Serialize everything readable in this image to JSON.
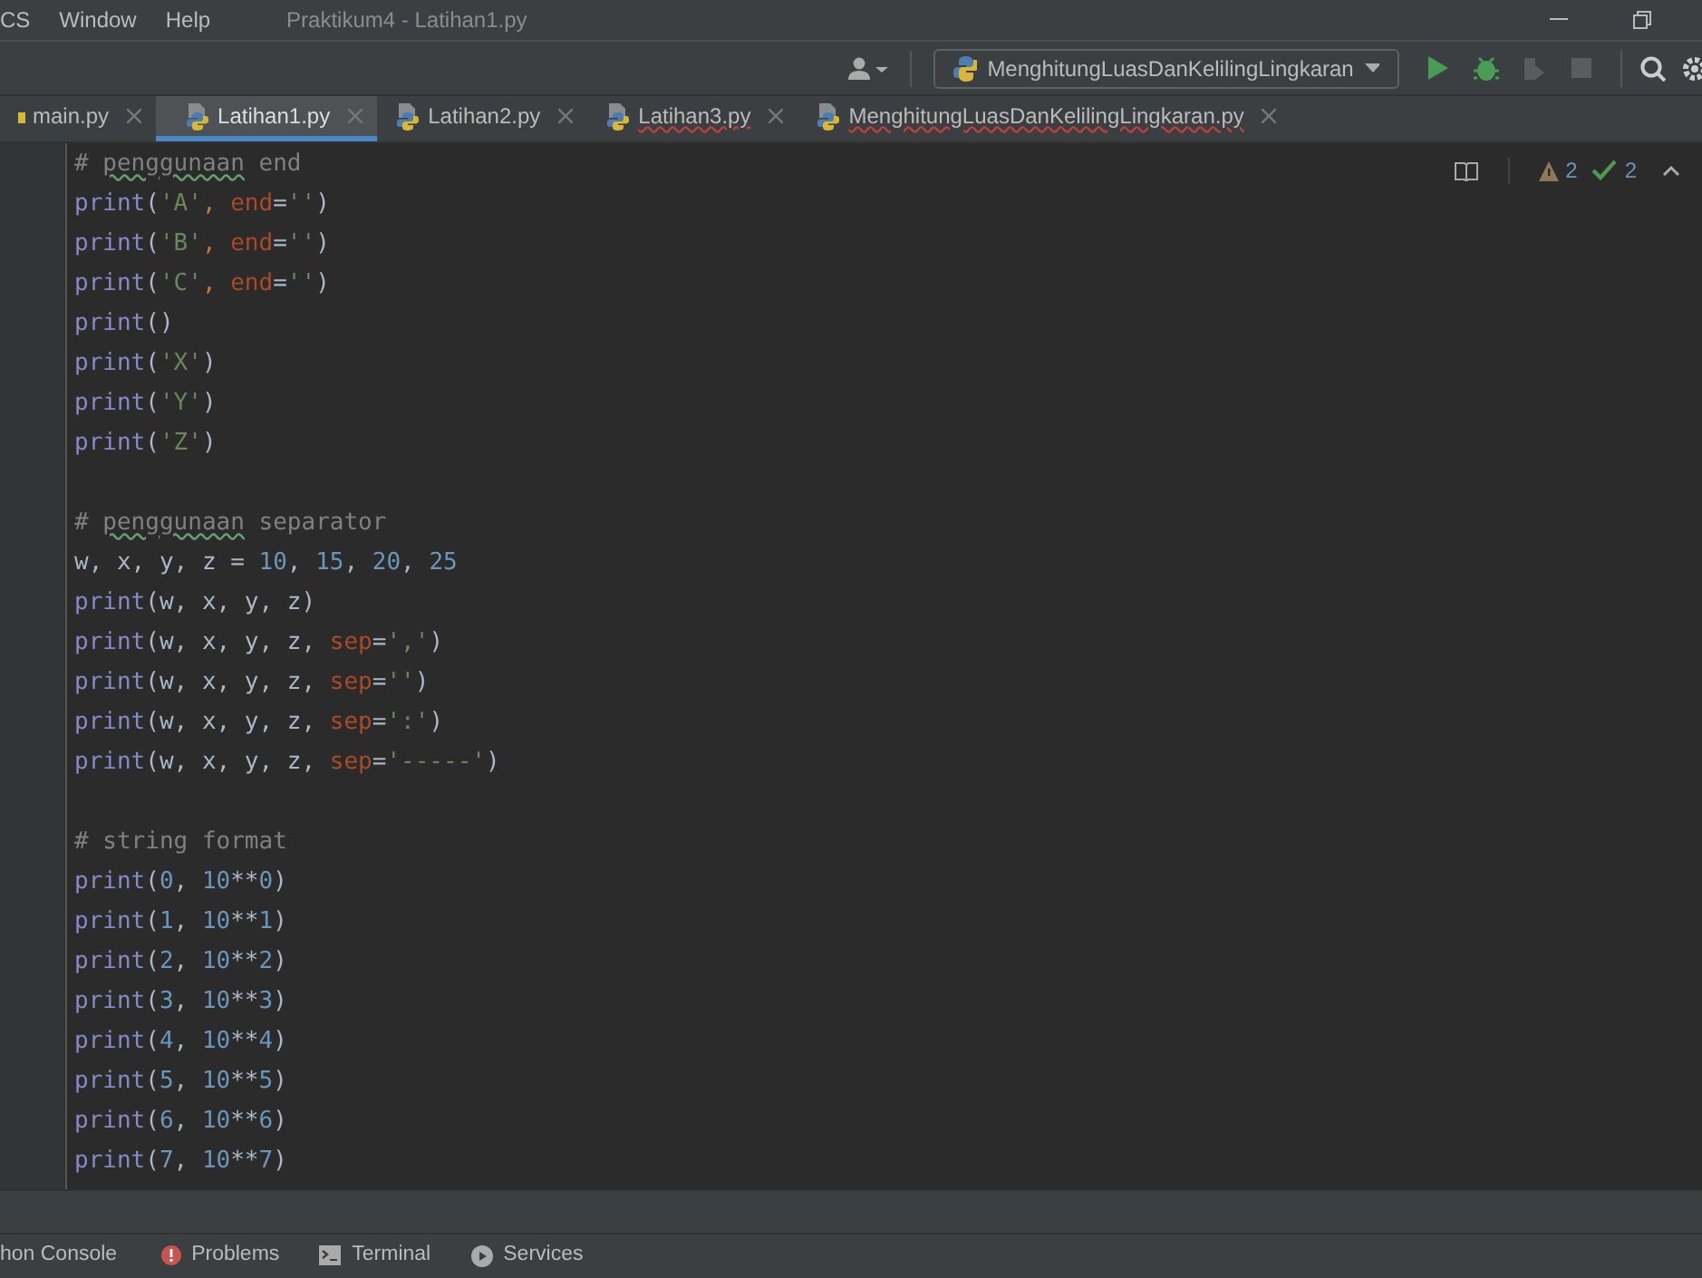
{
  "menu": [
    "CS",
    "Window",
    "Help"
  ],
  "window": {
    "title": "Praktikum4 - Latihan1.py"
  },
  "run_config": {
    "label": "MenghitungLuasDanKelilingLingkaran"
  },
  "tabs": [
    {
      "label": "main.py",
      "selected": false,
      "error": false
    },
    {
      "label": "Latihan1.py",
      "selected": true,
      "error": false
    },
    {
      "label": "Latihan2.py",
      "selected": false,
      "error": false
    },
    {
      "label": "Latihan3.py",
      "selected": false,
      "error": true
    },
    {
      "label": "MenghitungLuasDanKelilingLingkaran.py",
      "selected": false,
      "error": true
    }
  ],
  "inspections": {
    "warnings": "2",
    "weak_warnings": "2"
  },
  "code": [
    [
      {
        "kind": "comment",
        "text": "# "
      },
      {
        "kind": "typo",
        "text": "penggunaan"
      },
      {
        "kind": "comment",
        "text": " end"
      }
    ],
    [
      {
        "kind": "func",
        "text": "print"
      },
      {
        "kind": "plain",
        "text": "("
      },
      {
        "kind": "str",
        "text": "'A'"
      },
      {
        "kind": "sep",
        "text": ", "
      },
      {
        "kind": "param",
        "text": "end"
      },
      {
        "kind": "plain",
        "text": "="
      },
      {
        "kind": "str",
        "text": "''"
      },
      {
        "kind": "plain",
        "text": ")"
      }
    ],
    [
      {
        "kind": "func",
        "text": "print"
      },
      {
        "kind": "plain",
        "text": "("
      },
      {
        "kind": "str",
        "text": "'B'"
      },
      {
        "kind": "sep",
        "text": ", "
      },
      {
        "kind": "param",
        "text": "end"
      },
      {
        "kind": "plain",
        "text": "="
      },
      {
        "kind": "str",
        "text": "''"
      },
      {
        "kind": "plain",
        "text": ")"
      }
    ],
    [
      {
        "kind": "func",
        "text": "print"
      },
      {
        "kind": "plain",
        "text": "("
      },
      {
        "kind": "str",
        "text": "'C'"
      },
      {
        "kind": "sep",
        "text": ", "
      },
      {
        "kind": "param",
        "text": "end"
      },
      {
        "kind": "plain",
        "text": "="
      },
      {
        "kind": "str",
        "text": "''"
      },
      {
        "kind": "plain",
        "text": ")"
      }
    ],
    [
      {
        "kind": "func",
        "text": "print"
      },
      {
        "kind": "plain",
        "text": "()"
      }
    ],
    [
      {
        "kind": "func",
        "text": "print"
      },
      {
        "kind": "plain",
        "text": "("
      },
      {
        "kind": "str",
        "text": "'X'"
      },
      {
        "kind": "plain",
        "text": ")"
      }
    ],
    [
      {
        "kind": "func",
        "text": "print"
      },
      {
        "kind": "plain",
        "text": "("
      },
      {
        "kind": "str",
        "text": "'Y'"
      },
      {
        "kind": "plain",
        "text": ")"
      }
    ],
    [
      {
        "kind": "func",
        "text": "print"
      },
      {
        "kind": "plain",
        "text": "("
      },
      {
        "kind": "str",
        "text": "'Z'"
      },
      {
        "kind": "plain",
        "text": ")"
      }
    ],
    [
      {
        "kind": "blank"
      }
    ],
    [
      {
        "kind": "comment",
        "text": "# "
      },
      {
        "kind": "typo",
        "text": "penggunaan"
      },
      {
        "kind": "comment",
        "text": " separator"
      }
    ],
    [
      {
        "kind": "plain",
        "text": "w, x, y, z = "
      },
      {
        "kind": "num",
        "text": "10"
      },
      {
        "kind": "plain",
        "text": ", "
      },
      {
        "kind": "num",
        "text": "15"
      },
      {
        "kind": "plain",
        "text": ", "
      },
      {
        "kind": "num",
        "text": "20"
      },
      {
        "kind": "plain",
        "text": ", "
      },
      {
        "kind": "num",
        "text": "25"
      }
    ],
    [
      {
        "kind": "func",
        "text": "print"
      },
      {
        "kind": "plain",
        "text": "(w, x, y, z)"
      }
    ],
    [
      {
        "kind": "func",
        "text": "print"
      },
      {
        "kind": "plain",
        "text": "(w, x, y, z, "
      },
      {
        "kind": "param",
        "text": "sep"
      },
      {
        "kind": "plain",
        "text": "="
      },
      {
        "kind": "str",
        "text": "','"
      },
      {
        "kind": "plain",
        "text": ")"
      }
    ],
    [
      {
        "kind": "func",
        "text": "print"
      },
      {
        "kind": "plain",
        "text": "(w, x, y, z, "
      },
      {
        "kind": "param",
        "text": "sep"
      },
      {
        "kind": "plain",
        "text": "="
      },
      {
        "kind": "str",
        "text": "''"
      },
      {
        "kind": "plain",
        "text": ")"
      }
    ],
    [
      {
        "kind": "func",
        "text": "print"
      },
      {
        "kind": "plain",
        "text": "(w, x, y, z, "
      },
      {
        "kind": "param",
        "text": "sep"
      },
      {
        "kind": "plain",
        "text": "="
      },
      {
        "kind": "str",
        "text": "':'"
      },
      {
        "kind": "plain",
        "text": ")"
      }
    ],
    [
      {
        "kind": "func",
        "text": "print"
      },
      {
        "kind": "plain",
        "text": "(w, x, y, z, "
      },
      {
        "kind": "param",
        "text": "sep"
      },
      {
        "kind": "plain",
        "text": "="
      },
      {
        "kind": "str",
        "text": "'-----'"
      },
      {
        "kind": "plain",
        "text": ")"
      }
    ],
    [
      {
        "kind": "blank"
      }
    ],
    [
      {
        "kind": "comment",
        "text": "# string format"
      }
    ],
    [
      {
        "kind": "func",
        "text": "print"
      },
      {
        "kind": "plain",
        "text": "("
      },
      {
        "kind": "num",
        "text": "0"
      },
      {
        "kind": "plain",
        "text": ", "
      },
      {
        "kind": "num",
        "text": "10"
      },
      {
        "kind": "plain",
        "text": "**"
      },
      {
        "kind": "num",
        "text": "0"
      },
      {
        "kind": "plain",
        "text": ")"
      }
    ],
    [
      {
        "kind": "func",
        "text": "print"
      },
      {
        "kind": "plain",
        "text": "("
      },
      {
        "kind": "num",
        "text": "1"
      },
      {
        "kind": "plain",
        "text": ", "
      },
      {
        "kind": "num",
        "text": "10"
      },
      {
        "kind": "plain",
        "text": "**"
      },
      {
        "kind": "num",
        "text": "1"
      },
      {
        "kind": "plain",
        "text": ")"
      }
    ],
    [
      {
        "kind": "func",
        "text": "print"
      },
      {
        "kind": "plain",
        "text": "("
      },
      {
        "kind": "num",
        "text": "2"
      },
      {
        "kind": "plain",
        "text": ", "
      },
      {
        "kind": "num",
        "text": "10"
      },
      {
        "kind": "plain",
        "text": "**"
      },
      {
        "kind": "num",
        "text": "2"
      },
      {
        "kind": "plain",
        "text": ")"
      }
    ],
    [
      {
        "kind": "func",
        "text": "print"
      },
      {
        "kind": "plain",
        "text": "("
      },
      {
        "kind": "num",
        "text": "3"
      },
      {
        "kind": "plain",
        "text": ", "
      },
      {
        "kind": "num",
        "text": "10"
      },
      {
        "kind": "plain",
        "text": "**"
      },
      {
        "kind": "num",
        "text": "3"
      },
      {
        "kind": "plain",
        "text": ")"
      }
    ],
    [
      {
        "kind": "func",
        "text": "print"
      },
      {
        "kind": "plain",
        "text": "("
      },
      {
        "kind": "num",
        "text": "4"
      },
      {
        "kind": "plain",
        "text": ", "
      },
      {
        "kind": "num",
        "text": "10"
      },
      {
        "kind": "plain",
        "text": "**"
      },
      {
        "kind": "num",
        "text": "4"
      },
      {
        "kind": "plain",
        "text": ")"
      }
    ],
    [
      {
        "kind": "func",
        "text": "print"
      },
      {
        "kind": "plain",
        "text": "("
      },
      {
        "kind": "num",
        "text": "5"
      },
      {
        "kind": "plain",
        "text": ", "
      },
      {
        "kind": "num",
        "text": "10"
      },
      {
        "kind": "plain",
        "text": "**"
      },
      {
        "kind": "num",
        "text": "5"
      },
      {
        "kind": "plain",
        "text": ")"
      }
    ],
    [
      {
        "kind": "func",
        "text": "print"
      },
      {
        "kind": "plain",
        "text": "("
      },
      {
        "kind": "num",
        "text": "6"
      },
      {
        "kind": "plain",
        "text": ", "
      },
      {
        "kind": "num",
        "text": "10"
      },
      {
        "kind": "plain",
        "text": "**"
      },
      {
        "kind": "num",
        "text": "6"
      },
      {
        "kind": "plain",
        "text": ")"
      }
    ],
    [
      {
        "kind": "func",
        "text": "print"
      },
      {
        "kind": "plain",
        "text": "("
      },
      {
        "kind": "num",
        "text": "7"
      },
      {
        "kind": "plain",
        "text": ", "
      },
      {
        "kind": "num",
        "text": "10"
      },
      {
        "kind": "plain",
        "text": "**"
      },
      {
        "kind": "num",
        "text": "7"
      },
      {
        "kind": "plain",
        "text": ")"
      }
    ]
  ],
  "tool_windows": [
    {
      "label": "hon Console",
      "kind": "console"
    },
    {
      "label": "Problems",
      "kind": "problems"
    },
    {
      "label": "Terminal",
      "kind": "terminal"
    },
    {
      "label": "Services",
      "kind": "services"
    }
  ]
}
